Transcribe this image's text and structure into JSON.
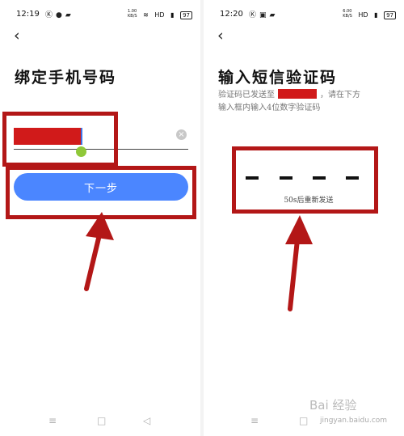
{
  "left": {
    "status": {
      "time": "12:19",
      "speed": "1.00\nKB/S",
      "network": "HD",
      "battery": "97"
    },
    "title": "绑定手机号码",
    "clear_icon": "×",
    "next_button": "下一步",
    "back_icon": "chevron-left"
  },
  "right": {
    "status": {
      "time": "12:20",
      "speed": "6.00\nKB/S",
      "network": "HD",
      "battery": "97"
    },
    "title": "输入短信验证码",
    "line1_before": "验证码已发送至",
    "line1_after": "，请在下方",
    "line2": "输入框内输入4位数字验证码",
    "resend": "50s后重新发送",
    "back_icon": "chevron-left"
  },
  "watermark": {
    "text": "Bai 经验",
    "url": "jingyan.baidu.com"
  },
  "colors": {
    "annotation_red": "#b31717",
    "button_blue": "#4b86ff",
    "mask_red": "#d11a1a",
    "highlight_green": "#8fc839"
  }
}
